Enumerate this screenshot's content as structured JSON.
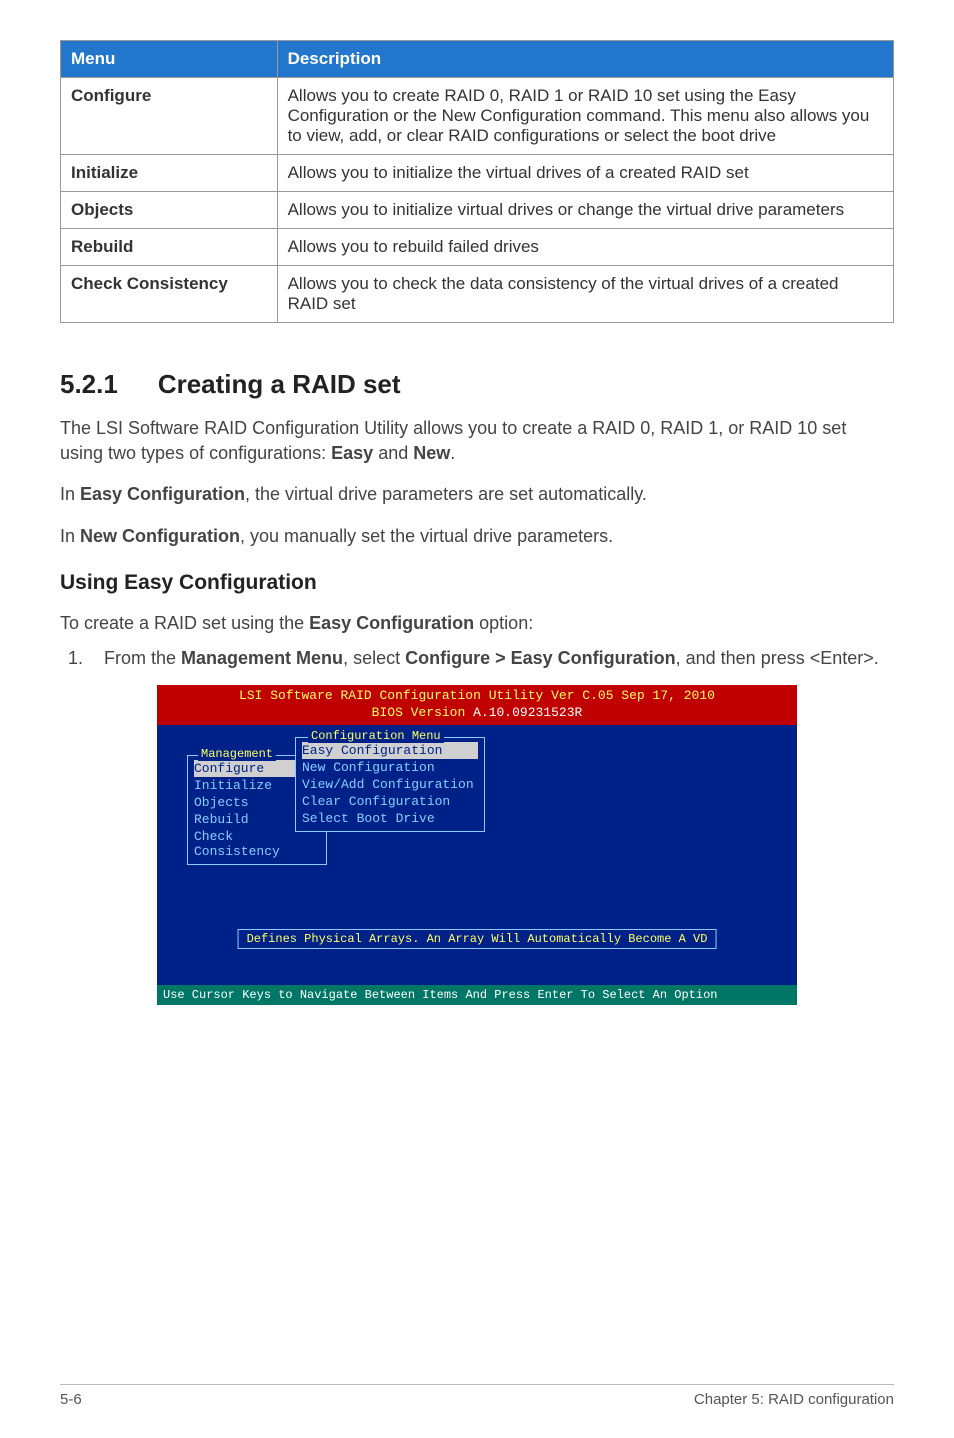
{
  "table": {
    "headers": [
      "Menu",
      "Description"
    ],
    "rows": [
      {
        "menu": "Configure",
        "desc": "Allows you to create RAID 0, RAID 1 or RAID 10 set using the Easy Configuration or the New Configuration command. This menu also allows you to view, add, or clear RAID configurations or select the boot drive"
      },
      {
        "menu": "Initialize",
        "desc": "Allows you to initialize the virtual drives of a created RAID set"
      },
      {
        "menu": "Objects",
        "desc": "Allows you to initialize virtual drives or change the virtual drive parameters"
      },
      {
        "menu": "Rebuild",
        "desc": "Allows you to rebuild failed drives"
      },
      {
        "menu": "Check Consistency",
        "desc": "Allows you to check the data consistency of the virtual drives of a created RAID set"
      }
    ]
  },
  "section": {
    "number": "5.2.1",
    "title": "Creating a RAID set",
    "p1a": "The LSI Software RAID Configuration Utility allows you to create a RAID 0, RAID 1, or RAID 10 set using two types of configurations: ",
    "p1b": "Easy",
    "p1c": " and ",
    "p1d": "New",
    "p1e": ".",
    "p2a": "In ",
    "p2b": "Easy Configuration",
    "p2c": ", the virtual drive parameters are set automatically.",
    "p3a": "In ",
    "p3b": "New Configuration",
    "p3c": ", you manually set the virtual drive parameters.",
    "sub": "Using Easy Configuration",
    "p4a": "To create a RAID set using the ",
    "p4b": "Easy Configuration",
    "p4c": " option:",
    "step1a": "From the ",
    "step1b": "Management Menu",
    "step1c": ", select ",
    "step1d": "Configure > Easy Configuration",
    "step1e": ", and then press <Enter>."
  },
  "bios": {
    "title_line1": "LSI Software RAID Configuration Utility Ver C.05 Sep 17, 2010",
    "title_line2a": "BIOS Version  ",
    "title_line2b": "A.10.09231523R",
    "mgmt_legend": "Management",
    "mgmt_items": [
      "Configure",
      "Initialize",
      "Objects",
      "Rebuild",
      "Check Consistency"
    ],
    "cfg_legend": "Configuration Menu",
    "cfg_items": [
      "Easy Configuration",
      "New Configuration",
      "View/Add Configuration",
      "Clear Configuration",
      "Select Boot Drive"
    ],
    "status": "Defines Physical Arrays. An Array Will Automatically Become A VD",
    "footer": "Use Cursor Keys to Navigate Between Items And Press Enter To Select An Option"
  },
  "footer": {
    "left": "5-6",
    "right": "Chapter 5: RAID configuration"
  }
}
